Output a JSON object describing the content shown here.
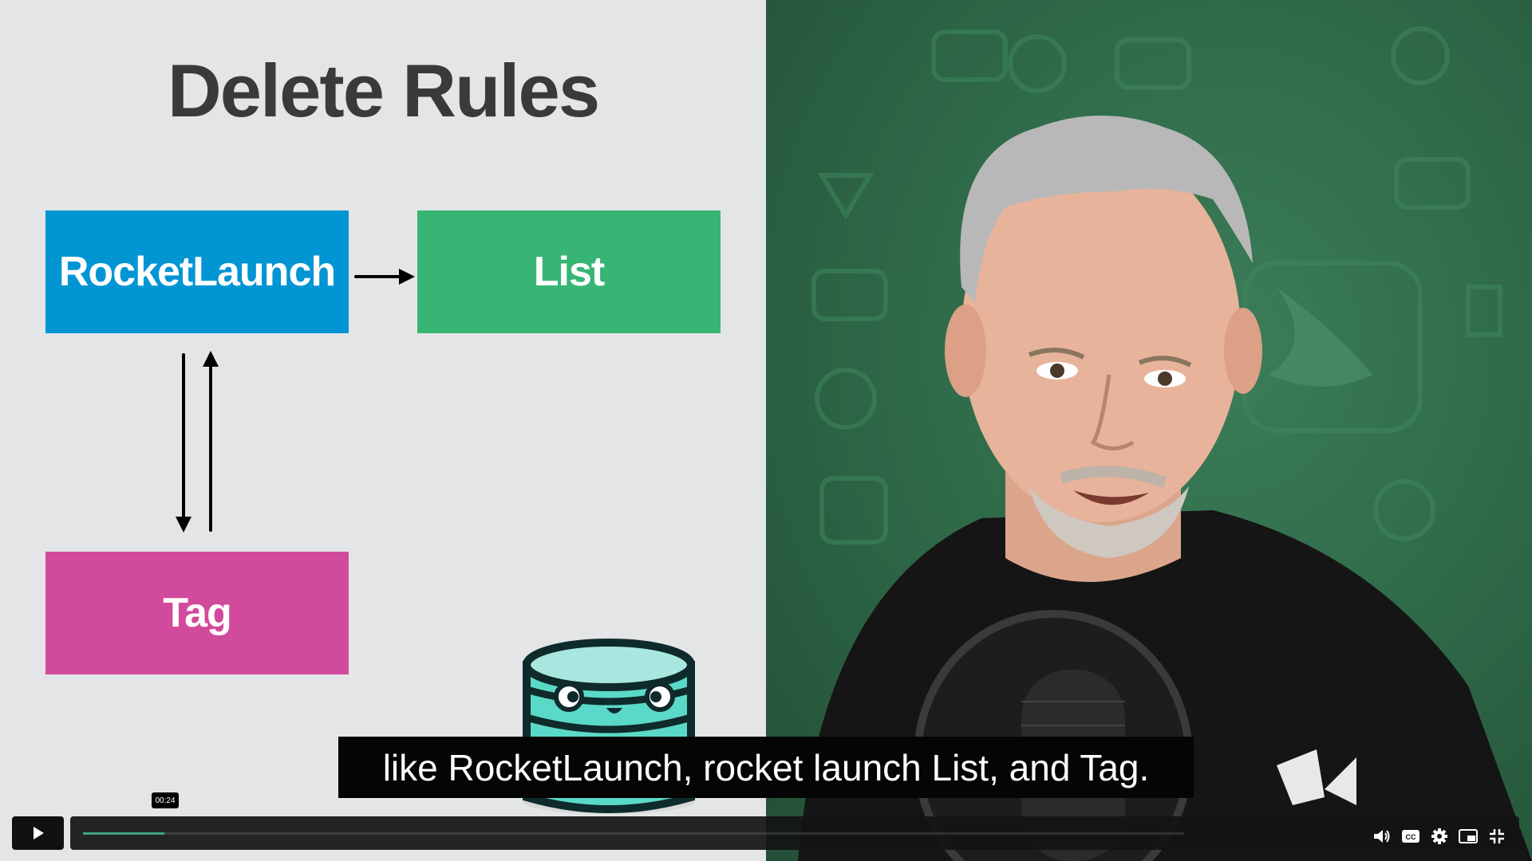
{
  "slide": {
    "title": "Delete Rules",
    "boxes": {
      "rocket_launch": "RocketLaunch",
      "list": "List",
      "tag": "Tag"
    },
    "colors": {
      "rocket_launch": "#0195d4",
      "list": "#38b575",
      "tag": "#d24a9b",
      "background": "#e3e5e6"
    }
  },
  "caption": {
    "text": "like RocketLaunch, rocket launch List, and Tag."
  },
  "player": {
    "current_time": "00:24",
    "progress_color": "#3fa37a",
    "controls": [
      "play-icon",
      "volume-icon",
      "closed-captions-icon",
      "settings-icon",
      "picture-in-picture-icon",
      "exit-fullscreen-icon"
    ],
    "cc_label": "CC"
  }
}
